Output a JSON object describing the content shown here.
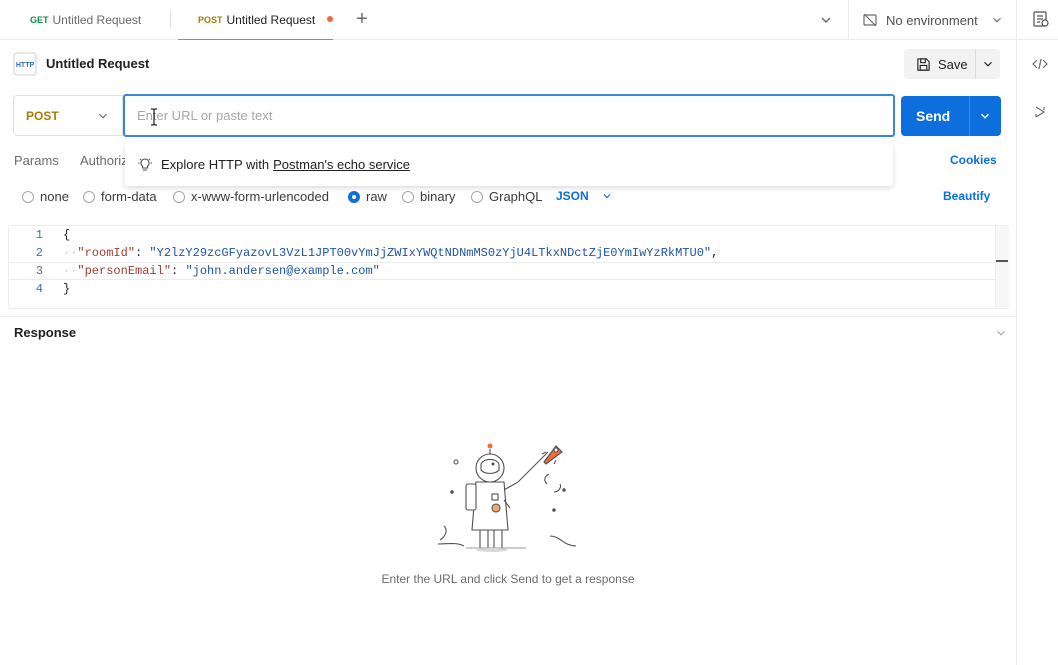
{
  "tabs": [
    {
      "method": "GET",
      "label": "Untitled Request"
    },
    {
      "method": "POST",
      "label": "Untitled Request"
    }
  ],
  "environment": {
    "label": "No environment"
  },
  "request": {
    "title": "Untitled Request",
    "method": "POST",
    "url_placeholder": "Enter URL or paste text",
    "save_label": "Save",
    "send_label": "Send"
  },
  "request_tabs": [
    "Params",
    "Authoriz"
  ],
  "cookies_label": "Cookies",
  "suggestion": {
    "prefix": "Explore HTTP with",
    "link": "Postman's echo service"
  },
  "body_options": [
    "none",
    "form-data",
    "x-www-form-urlencoded",
    "raw",
    "binary",
    "GraphQL"
  ],
  "selected_body_option": "raw",
  "body_language": "JSON",
  "beautify_label": "Beautify",
  "editor": {
    "line_numbers": [
      "1",
      "2",
      "3",
      "4"
    ],
    "open_brace": "{",
    "key1": "\"roomId\"",
    "val1": "\"Y2lzY29zcGFyazovL3VzL1JPT00vYmJjZWIxYWQtNDNmMS0zYjU4LTkxNDctZjE0YmIwYzRkMTU0\"",
    "key2": "\"personEmail\"",
    "val2": "\"john.andersen@example.com\"",
    "close_brace": "}"
  },
  "response": {
    "title": "Response",
    "empty_message": "Enter the URL and click Send to get a response"
  },
  "colors": {
    "accent": "#0c6fdd",
    "post": "#ad7a03",
    "get": "#0a8f4e",
    "unsaved": "#f26b3a"
  }
}
